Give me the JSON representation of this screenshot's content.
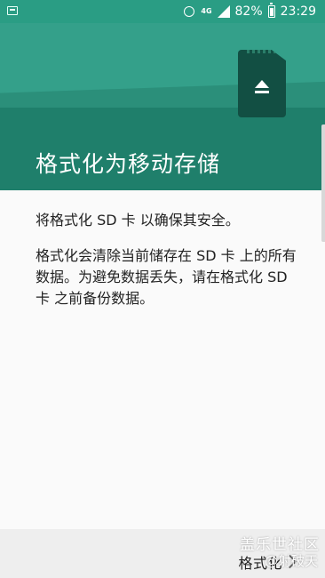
{
  "status_bar": {
    "network_label": "4G",
    "battery": "82%",
    "time": "23:29"
  },
  "hero": {
    "title": "格式化为移动存储",
    "icon": "sd-card-eject-icon"
  },
  "content": {
    "paragraph1": "将格式化 SD 卡 以确保其安全。",
    "paragraph2": "格式化会清除当前储存在 SD 卡 上的所有数据。为避免数据丢失，请在格式化 SD 卡 之前备份数据。"
  },
  "footer": {
    "primary_label": "格式化",
    "watermark_top": "盖乐世社区",
    "watermark_bottom": "@射破天"
  },
  "colors": {
    "accent": "#2c9d83",
    "accent_dark": "#1f7f6b",
    "background": "#fafafa"
  }
}
